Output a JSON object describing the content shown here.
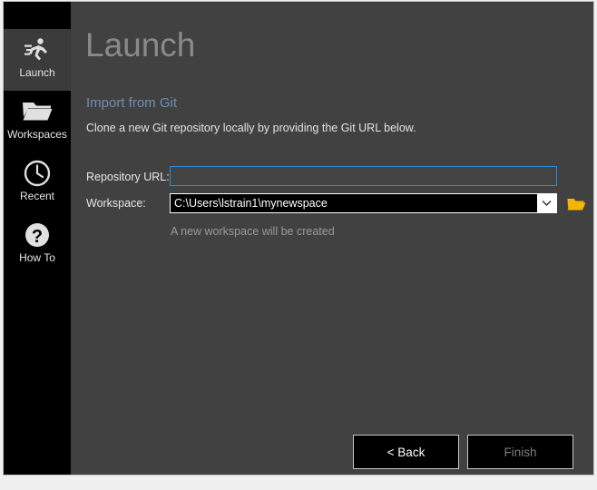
{
  "window": {
    "close_label": "✕"
  },
  "sidebar": {
    "items": [
      {
        "label": "Launch",
        "icon": "runner-icon",
        "selected": true
      },
      {
        "label": "Workspaces",
        "icon": "folder-icon",
        "selected": false
      },
      {
        "label": "Recent",
        "icon": "clock-icon",
        "selected": false
      },
      {
        "label": "How To",
        "icon": "question-icon",
        "selected": false
      }
    ]
  },
  "main": {
    "title": "Launch",
    "section_heading": "Import from Git",
    "section_description": "Clone a new Git repository locally by providing the Git URL below."
  },
  "form": {
    "repo_url_label": "Repository URL:",
    "repo_url_value": "",
    "repo_url_placeholder": "",
    "workspace_label": "Workspace:",
    "workspace_value": "C:\\Users\\lstrain1\\mynewspace",
    "workspace_hint": "A new workspace will be created",
    "browse_icon": "open-folder-icon",
    "dropdown_icon": "chevron-down-icon"
  },
  "footer": {
    "back_label": "< Back",
    "finish_label": "Finish"
  },
  "colors": {
    "window_bg": "#414141",
    "sidebar_bg": "#000000",
    "sidebar_selected_bg": "#3b3b3b",
    "heading_blue": "#6e8fb0",
    "focus_border": "#2b8ae0",
    "folder_gold": "#f2b705",
    "title_gray": "#8a8a8a",
    "disabled_text": "#7d7d7d"
  }
}
